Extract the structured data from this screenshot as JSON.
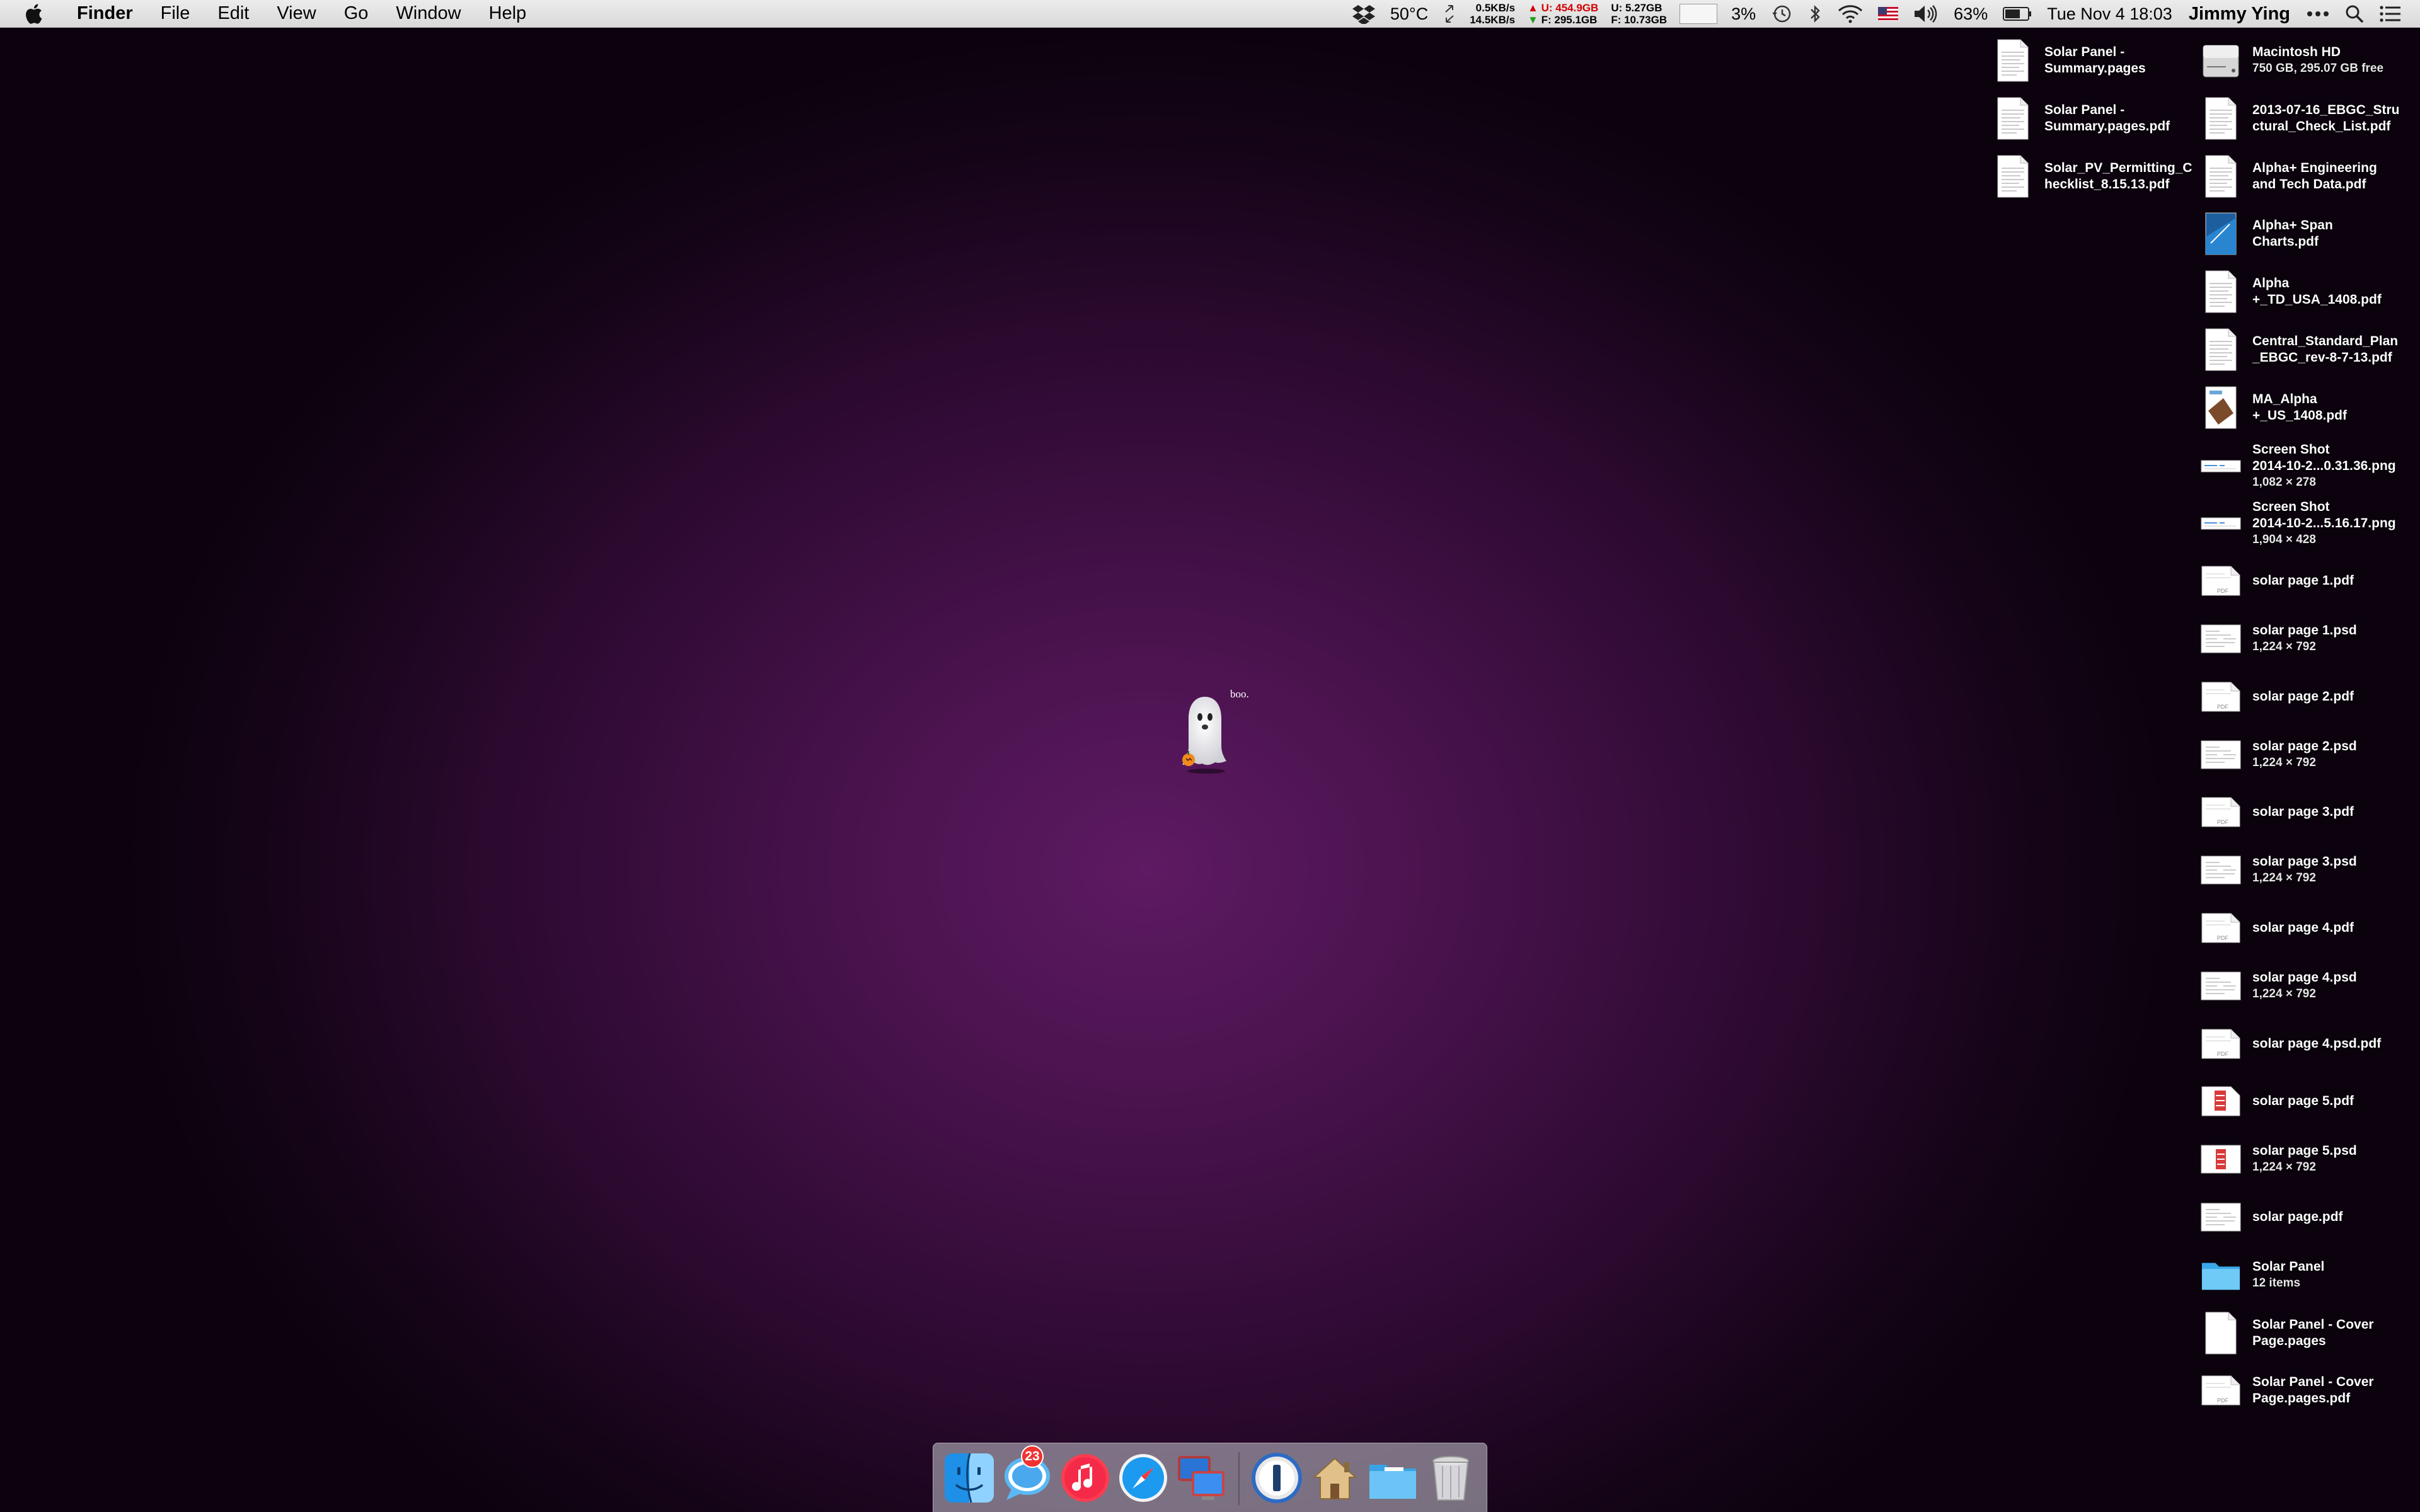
{
  "menubar": {
    "app": "Finder",
    "items": [
      "File",
      "Edit",
      "View",
      "Go",
      "Window",
      "Help"
    ],
    "temperature": "50°C",
    "net_up": "0.5KB/s",
    "net_down": "14.5KB/s",
    "disk1_used_label": "U: 454.9GB",
    "disk1_free_label": "F: 295.1GB",
    "disk2_used_label": "U:  5.27GB",
    "disk2_free_label": "F: 10.73GB",
    "cpu": "3%",
    "battery": "63%",
    "datetime": "Tue Nov 4  18:03",
    "user": "Jimmy Ying"
  },
  "desktop": {
    "ghost_text": "boo.",
    "left_column": [
      {
        "line1": "Solar Panel -",
        "line2": "Summary.pages",
        "sub": ""
      },
      {
        "line1": "Solar Panel -",
        "line2": "Summary.pages.pdf",
        "sub": ""
      },
      {
        "line1": "Solar_PV_Permitting_C",
        "line2": "hecklist_8.15.13.pdf",
        "sub": ""
      }
    ],
    "right_column": [
      {
        "line1": "Macintosh HD",
        "line2": "",
        "sub": "750 GB, 295.07 GB free",
        "kind": "disk"
      },
      {
        "line1": "2013-07-16_EBGC_Stru",
        "line2": "ctural_Check_List.pdf",
        "sub": "",
        "kind": "doc"
      },
      {
        "line1": "Alpha+ Engineering",
        "line2": "and Tech Data.pdf",
        "sub": "",
        "kind": "doc"
      },
      {
        "line1": "Alpha+ Span",
        "line2": "Charts.pdf",
        "sub": "",
        "kind": "blue"
      },
      {
        "line1": "Alpha",
        "line2": "+_TD_USA_1408.pdf",
        "sub": "",
        "kind": "doc"
      },
      {
        "line1": "Central_Standard_Plan",
        "line2": "_EBGC_rev-8-7-13.pdf",
        "sub": "",
        "kind": "doc"
      },
      {
        "line1": "MA_Alpha",
        "line2": "+_US_1408.pdf",
        "sub": "",
        "kind": "photo"
      },
      {
        "line1": "Screen Shot",
        "line2": "2014-10-2...0.31.36.png",
        "sub": "1,082 × 278",
        "kind": "wide"
      },
      {
        "line1": "Screen Shot",
        "line2": "2014-10-2...5.16.17.png",
        "sub": "1,904 × 428",
        "kind": "wide"
      },
      {
        "line1": "solar page 1.pdf",
        "line2": "",
        "sub": "",
        "kind": "pdf"
      },
      {
        "line1": "solar page 1.psd",
        "line2": "",
        "sub": "1,224 × 792",
        "kind": "psd"
      },
      {
        "line1": "solar page 2.pdf",
        "line2": "",
        "sub": "",
        "kind": "pdf"
      },
      {
        "line1": "solar page 2.psd",
        "line2": "",
        "sub": "1,224 × 792",
        "kind": "psd"
      },
      {
        "line1": "solar page 3.pdf",
        "line2": "",
        "sub": "",
        "kind": "pdf"
      },
      {
        "line1": "solar page 3.psd",
        "line2": "",
        "sub": "1,224 × 792",
        "kind": "psd"
      },
      {
        "line1": "solar page 4.pdf",
        "line2": "",
        "sub": "",
        "kind": "pdf"
      },
      {
        "line1": "solar page 4.psd",
        "line2": "",
        "sub": "1,224 × 792",
        "kind": "psd"
      },
      {
        "line1": "solar page 4.psd.pdf",
        "line2": "",
        "sub": "",
        "kind": "pdf"
      },
      {
        "line1": "solar page 5.pdf",
        "line2": "",
        "sub": "",
        "kind": "redpdf"
      },
      {
        "line1": "solar page 5.psd",
        "line2": "",
        "sub": "1,224 × 792",
        "kind": "redpsd"
      },
      {
        "line1": "solar page.pdf",
        "line2": "",
        "sub": "",
        "kind": "psd"
      },
      {
        "line1": "Solar Panel",
        "line2": "",
        "sub": "12 items",
        "kind": "folder"
      },
      {
        "line1": "Solar Panel - Cover",
        "line2": "Page.pages",
        "sub": "",
        "kind": "blank"
      },
      {
        "line1": "Solar Panel - Cover",
        "line2": "Page.pages.pdf",
        "sub": "",
        "kind": "pdf"
      }
    ]
  },
  "dock": {
    "messages_badge": "23",
    "apps": [
      "finder-icon",
      "messages-icon",
      "itunes-icon",
      "safari-icon",
      "remote-desktop-icon",
      "1password-icon",
      "home-folder-icon",
      "documents-folder-icon",
      "trash-icon"
    ]
  },
  "colors": {
    "wallpaper_center": "#5e1a62",
    "wallpaper_edge": "#0b020d",
    "badge": "#f0322f",
    "folder": "#5bc3f5"
  }
}
